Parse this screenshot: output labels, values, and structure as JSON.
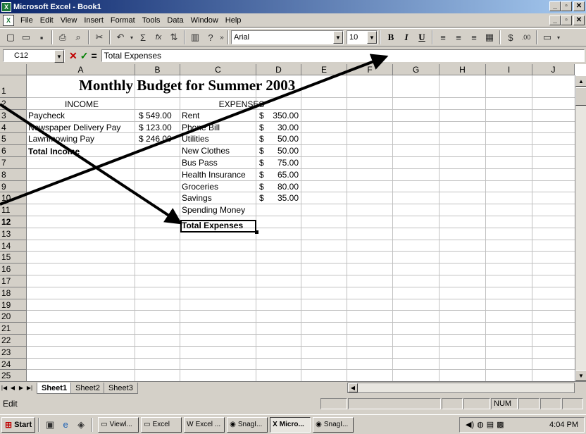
{
  "window": {
    "title": "Microsoft Excel - Book1",
    "app_icon": "X"
  },
  "menu": [
    "File",
    "Edit",
    "View",
    "Insert",
    "Format",
    "Tools",
    "Data",
    "Window",
    "Help"
  ],
  "toolbar": {
    "font_name": "Arial",
    "font_size": "10",
    "bold": "B",
    "italic": "I",
    "underline": "U",
    "autosum": "Σ",
    "fx": "fx"
  },
  "formula_bar": {
    "name_box": "C12",
    "cancel": "✕",
    "enter": "✓",
    "equals": "=",
    "content": "Total Expenses"
  },
  "columns": [
    "A",
    "B",
    "C",
    "D",
    "E",
    "F",
    "G",
    "H",
    "I",
    "J"
  ],
  "rows": [
    "1",
    "2",
    "3",
    "4",
    "5",
    "6",
    "7",
    "8",
    "9",
    "10",
    "11",
    "12",
    "13",
    "14",
    "15",
    "16",
    "17",
    "18",
    "19",
    "20",
    "21",
    "22",
    "23",
    "24",
    "25"
  ],
  "active_row": "12",
  "sheet": {
    "title": "Monthly Budget for Summer 2003",
    "income_header": "INCOME",
    "expenses_header": "EXPENSES",
    "income": [
      {
        "label": "Paycheck",
        "amount": "$ 549.00"
      },
      {
        "label": "Newspaper Delivery Pay",
        "amount": "$ 123.00"
      },
      {
        "label": "Lawnmowing Pay",
        "amount": "$ 246.00"
      }
    ],
    "total_income_label": "Total Income",
    "expenses": [
      {
        "label": "Rent",
        "currency": "$",
        "amount": "350.00"
      },
      {
        "label": "Phone Bill",
        "currency": "$",
        "amount": "30.00"
      },
      {
        "label": "Utilities",
        "currency": "$",
        "amount": "50.00"
      },
      {
        "label": "New Clothes",
        "currency": "$",
        "amount": "50.00"
      },
      {
        "label": "Bus Pass",
        "currency": "$",
        "amount": "75.00"
      },
      {
        "label": "Health Insurance",
        "currency": "$",
        "amount": "65.00"
      },
      {
        "label": "Groceries",
        "currency": "$",
        "amount": "80.00"
      },
      {
        "label": "Savings",
        "currency": "$",
        "amount": "35.00"
      },
      {
        "label": "Spending Money",
        "currency": "",
        "amount": ""
      }
    ],
    "total_expenses_label": "Total Expenses"
  },
  "sheet_tabs": [
    "Sheet1",
    "Sheet2",
    "Sheet3"
  ],
  "status": {
    "mode": "Edit",
    "num": "NUM"
  },
  "taskbar": {
    "start": "Start",
    "tasks": [
      "Viewl...",
      "Excel",
      "Excel ...",
      "SnagI...",
      "Micro...",
      "SnagI..."
    ],
    "active_task": "Micro...",
    "clock": "4:04 PM"
  }
}
